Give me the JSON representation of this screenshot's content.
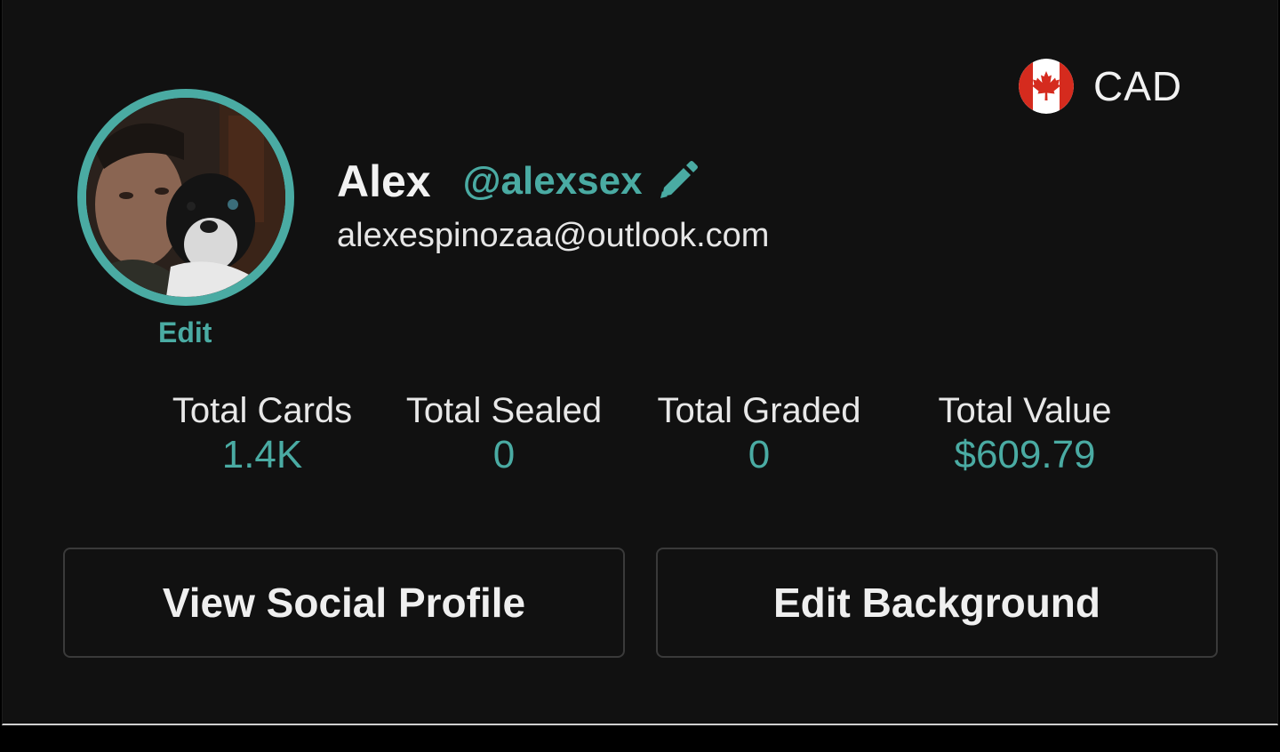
{
  "currency": {
    "code": "CAD",
    "flag_icon": "canada-flag-icon"
  },
  "profile": {
    "avatar_edit_label": "Edit",
    "name": "Alex",
    "handle": "@alexsex",
    "email": "alexespinozaa@outlook.com"
  },
  "stats": [
    {
      "label": "Total Cards",
      "value": "1.4K"
    },
    {
      "label": "Total Sealed",
      "value": "0"
    },
    {
      "label": "Total Graded",
      "value": "0"
    },
    {
      "label": "Total Value",
      "value": "$609.79"
    }
  ],
  "actions": {
    "view_social_profile_label": "View Social Profile",
    "edit_background_label": "Edit Background"
  },
  "colors": {
    "accent": "#4aaba3",
    "background": "#111111",
    "text": "#f2f2f2"
  }
}
